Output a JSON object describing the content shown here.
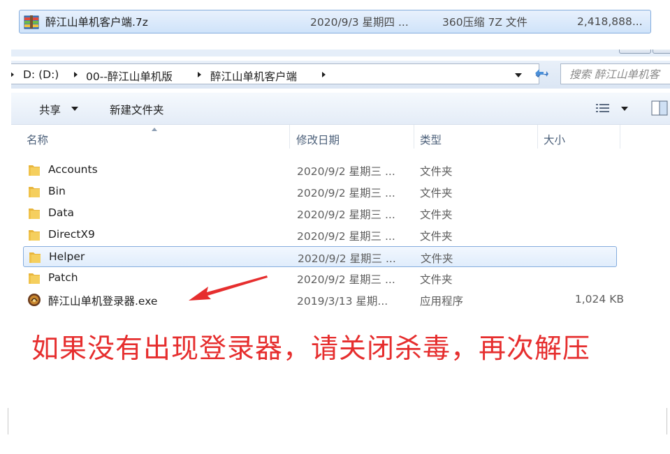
{
  "archive": {
    "name": "醉江山单机客户端.7z",
    "date": "2020/9/3 星期四 ...",
    "type": "360压缩 7Z 文件",
    "size": "2,418,888..."
  },
  "address": {
    "segments": [
      "D: (D:)",
      "00--醉江山单机版",
      "醉江山单机客户端"
    ],
    "search_placeholder": "搜索 醉江山单机客"
  },
  "toolbar": {
    "share_label": "共享",
    "new_folder_label": "新建文件夹"
  },
  "columns": {
    "name": "名称",
    "date": "修改日期",
    "type": "类型",
    "size": "大小"
  },
  "files": [
    {
      "name": "Accounts",
      "date": "2020/9/2 星期三 ...",
      "type": "文件夹",
      "size": "",
      "icon": "folder-icon"
    },
    {
      "name": "Bin",
      "date": "2020/9/2 星期三 ...",
      "type": "文件夹",
      "size": "",
      "icon": "folder-icon"
    },
    {
      "name": "Data",
      "date": "2020/9/2 星期三 ...",
      "type": "文件夹",
      "size": "",
      "icon": "folder-icon"
    },
    {
      "name": "DirectX9",
      "date": "2020/9/2 星期三 ...",
      "type": "文件夹",
      "size": "",
      "icon": "folder-icon"
    },
    {
      "name": "Helper",
      "date": "2020/9/2 星期三 ...",
      "type": "文件夹",
      "size": "",
      "icon": "folder-icon",
      "selected": true
    },
    {
      "name": "Patch",
      "date": "2020/9/2 星期三 ...",
      "type": "文件夹",
      "size": "",
      "icon": "folder-icon"
    },
    {
      "name": "醉江山单机登录器.exe",
      "date": "2019/3/13 星期...",
      "type": "应用程序",
      "size": "1,024 KB",
      "icon": "game-app-icon"
    }
  ],
  "notice": "如果没有出现登录器，请关闭杀毒，再次解压",
  "colors": {
    "selection_border": "#84acdd",
    "notice_red": "#e62e2e",
    "arrow_red": "#e62e2e",
    "folder_yellow": "#f2c34a"
  }
}
